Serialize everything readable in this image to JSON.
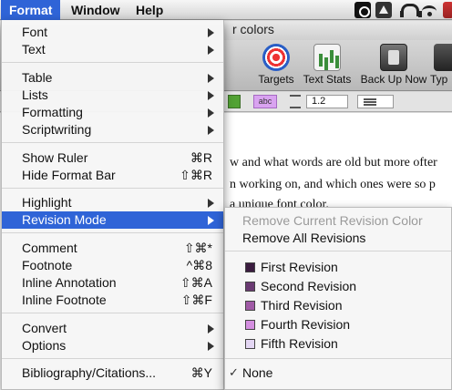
{
  "menubar": {
    "items": [
      "Format",
      "Window",
      "Help"
    ],
    "accent_color": "#2f64d7",
    "status_icons": [
      "camera-icon",
      "drive-icon",
      "headphones-icon",
      "wifi-icon",
      "flag-icon"
    ]
  },
  "window": {
    "title": "r colors",
    "toolbar": {
      "targets": "Targets",
      "text_stats": "Text Stats",
      "back_up_now": "Back Up Now",
      "type": "Typ"
    },
    "format_bar": {
      "highlight_label": "abc",
      "line_spacing": "1.2",
      "text_color": "#52a234",
      "highlight_color": "#d9a3f0"
    },
    "document": {
      "lines": [
        "w and what words are old but more ofter",
        "n working on, and which ones were so p",
        "a unique font color."
      ]
    }
  },
  "format_menu": {
    "groups": [
      [
        {
          "label": "Font",
          "submenu": true
        },
        {
          "label": "Text",
          "submenu": true
        }
      ],
      [
        {
          "label": "Table",
          "submenu": true
        },
        {
          "label": "Lists",
          "submenu": true
        },
        {
          "label": "Formatting",
          "submenu": true
        },
        {
          "label": "Scriptwriting",
          "submenu": true
        }
      ],
      [
        {
          "label": "Show Ruler",
          "shortcut": "⌘R"
        },
        {
          "label": "Hide Format Bar",
          "shortcut": "⇧⌘R"
        }
      ],
      [
        {
          "label": "Highlight",
          "submenu": true
        },
        {
          "label": "Revision Mode",
          "submenu": true,
          "highlighted": true
        }
      ],
      [
        {
          "label": "Comment",
          "shortcut": "⇧⌘*"
        },
        {
          "label": "Footnote",
          "shortcut": "^⌘8"
        },
        {
          "label": "Inline Annotation",
          "shortcut": "⇧⌘A"
        },
        {
          "label": "Inline Footnote",
          "shortcut": "⇧⌘F"
        }
      ],
      [
        {
          "label": "Convert",
          "submenu": true
        },
        {
          "label": "Options",
          "submenu": true
        }
      ],
      [
        {
          "label": "Bibliography/Citations...",
          "shortcut": "⌘Y"
        }
      ]
    ]
  },
  "revision_submenu": {
    "remove_current": "Remove Current Revision Color",
    "remove_all": "Remove All Revisions",
    "revisions": [
      {
        "label": "First Revision",
        "color": "#3b1c3f"
      },
      {
        "label": "Second Revision",
        "color": "#6a3a72"
      },
      {
        "label": "Third Revision",
        "color": "#a05aa6"
      },
      {
        "label": "Fourth Revision",
        "color": "#d48fe0"
      },
      {
        "label": "Fifth Revision",
        "color": "#e3d6f3"
      }
    ],
    "none": "None",
    "checkmark": "✓"
  }
}
